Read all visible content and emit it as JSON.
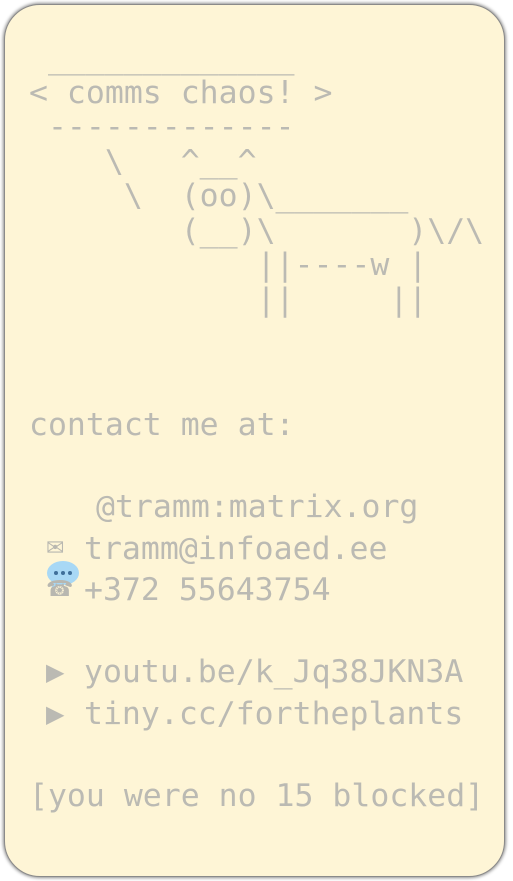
{
  "ascii_art": " _____________\n< comms chaos! >\n -------------\n    \\   ^__^\n     \\  (oo)\\_______\n        (__)\\       )\\/\\\n            ||----w |\n            ||     ||",
  "contact_heading": "contact me at:",
  "contacts": [
    {
      "icon": "speech-bubble-icon",
      "text": "@tramm:matrix.org"
    },
    {
      "icon": "envelope-icon",
      "text": "tramm@infoaed.ee"
    },
    {
      "icon": "telephone-icon",
      "text": "+372 55643754"
    }
  ],
  "links": [
    {
      "icon": "play-icon",
      "text": "youtu.be/k_Jq38JKN3A"
    },
    {
      "icon": "play-icon",
      "text": "tiny.cc/fortheplants"
    }
  ],
  "footer": "[you were no 15 blocked]",
  "colors": {
    "card_background": "#fef5d6",
    "text": "#bbbab3",
    "chat_icon": "#a8d8f5"
  }
}
